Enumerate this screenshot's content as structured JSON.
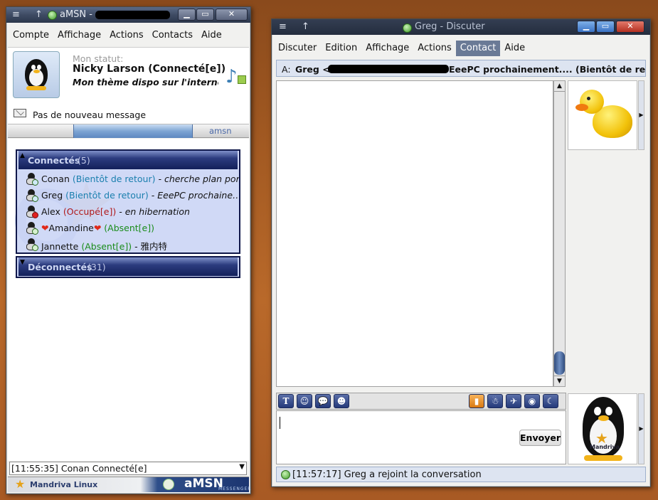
{
  "amsn": {
    "title": "aMSN -",
    "menu": [
      "Compte",
      "Affichage",
      "Actions",
      "Contacts",
      "Aide"
    ],
    "status_label": "Mon statut:",
    "status_name": "Nicky Larson (Connecté[e])",
    "status_message": "Mon thème dispo sur l'internet, c",
    "mail_text": "Pas de nouveau message",
    "brand_small": "amsn",
    "groups": {
      "online_name": "Connectés",
      "online_count": "(5)",
      "offline_name": "Déconnectés",
      "offline_count": "(31)"
    },
    "contacts": [
      {
        "name": "Conan",
        "status": "(Bientôt de retour)",
        "message": "- cherche plan port…",
        "kind": "away"
      },
      {
        "name": "Greg",
        "status": "(Bientôt de retour)",
        "message": "- EeePC prochaine…",
        "kind": "away"
      },
      {
        "name": "Alex",
        "status": "(Occupé[e])",
        "message": "- en hibernation",
        "kind": "busy"
      },
      {
        "name": "Amandine",
        "status": "(Absent[e])",
        "message": "",
        "kind": "absent"
      },
      {
        "name": "Jannette",
        "status": "(Absent[e])",
        "message": "- 雅内特",
        "kind": "absent"
      }
    ],
    "event_log": "[11:55:35] Conan Connecté[e]",
    "footer_left": "Mandriva Linux",
    "footer_right": "aMSN",
    "footer_right_sub": "MESSENGER"
  },
  "chat": {
    "title": "Greg - Discuter",
    "menu": [
      "Discuter",
      "Edition",
      "Affichage",
      "Actions",
      "Contact",
      "Aide"
    ],
    "selected_menu": "Contact",
    "to_label": "A:",
    "to_name": "Greg <",
    "to_rest": "EeePC prochainement.... (Bientôt de retour)",
    "send_button": "Envoyer",
    "input_value": "",
    "status_message": "[11:57:17] Greg a rejoint la conversation",
    "penguin_label": "Mandriva"
  }
}
